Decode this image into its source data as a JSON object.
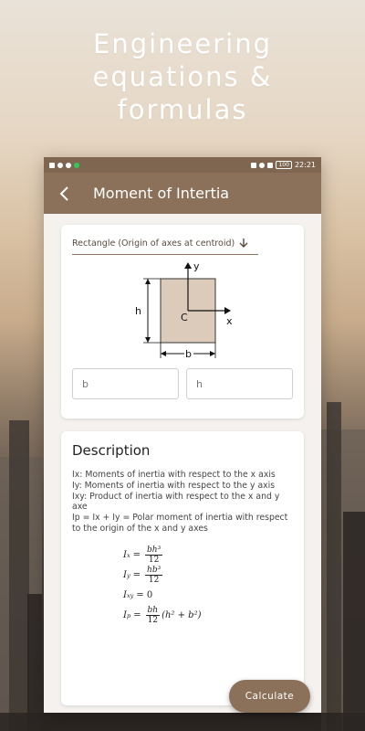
{
  "promo": {
    "line1": "Engineering",
    "line2": "equations &",
    "line3": "formulas"
  },
  "statusbar": {
    "time": "22:21",
    "battery": "100"
  },
  "appbar": {
    "title": "Moment of Intertia"
  },
  "shape_selector": {
    "value": "Rectangle (Origin of axes at centroid)"
  },
  "diagram": {
    "axis_y": "y",
    "axis_x": "x",
    "height_label": "h",
    "width_label": "b",
    "centroid_label": "C"
  },
  "inputs": {
    "b_placeholder": "b",
    "h_placeholder": "h"
  },
  "description": {
    "title": "Description",
    "lines": [
      "Ix: Moments of inertia with respect to the x axis",
      "Iy: Moments of inertia with respect to the y axis",
      "Ixy: Product of inertia with respect to the x and y axe",
      "Ip = Ix + Iy = Polar moment of inertia with respect to the origin of the x and y axes"
    ]
  },
  "formulas": {
    "ix_lhs": "I",
    "ix_sub": "x",
    "ix_num": "bh³",
    "ix_den": "12",
    "iy_lhs": "I",
    "iy_sub": "y",
    "iy_num": "hb³",
    "iy_den": "12",
    "ixy_lhs": "I",
    "ixy_sub": "xy",
    "ixy_rhs": "= 0",
    "ip_lhs": "I",
    "ip_sub": "p",
    "ip_num": "bh",
    "ip_den": "12",
    "ip_tail": "(h² + b²)"
  },
  "buttons": {
    "calculate": "Calculate"
  },
  "colors": {
    "appbar": "#8b7159",
    "statusbar": "#7e6651",
    "shape_fill": "#dccbbb"
  }
}
